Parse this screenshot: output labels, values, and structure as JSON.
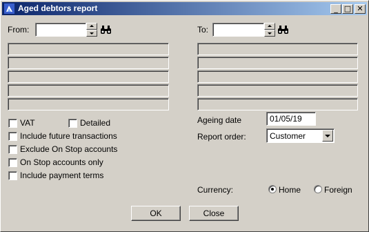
{
  "window": {
    "title": "Aged debtors report"
  },
  "title_buttons": {
    "minimize": "_",
    "maximize": "□",
    "close": "✕"
  },
  "range": {
    "from_label": "From:",
    "from_value": "",
    "to_label": "To:",
    "to_value": ""
  },
  "options": {
    "vat": {
      "label": "VAT",
      "checked": false
    },
    "detailed": {
      "label": "Detailed",
      "checked": false
    },
    "future": {
      "label": "Include future transactions",
      "checked": false
    },
    "exclude_stop": {
      "label": "Exclude On Stop accounts",
      "checked": false
    },
    "stop_only": {
      "label": "On Stop accounts only",
      "checked": false
    },
    "payment_terms": {
      "label": "Include payment terms",
      "checked": false
    }
  },
  "ageing": {
    "label": "Ageing date",
    "value": "01/05/19"
  },
  "report_order": {
    "label": "Report order:",
    "value": "Customer"
  },
  "currency": {
    "label": "Currency:",
    "options": [
      "Home",
      "Foreign"
    ],
    "selected": "Home"
  },
  "buttons": {
    "ok": "OK",
    "close": "Close"
  },
  "colors": {
    "face": "#d4d0c8",
    "title_start": "#0a246a",
    "title_end": "#a6caf0"
  }
}
